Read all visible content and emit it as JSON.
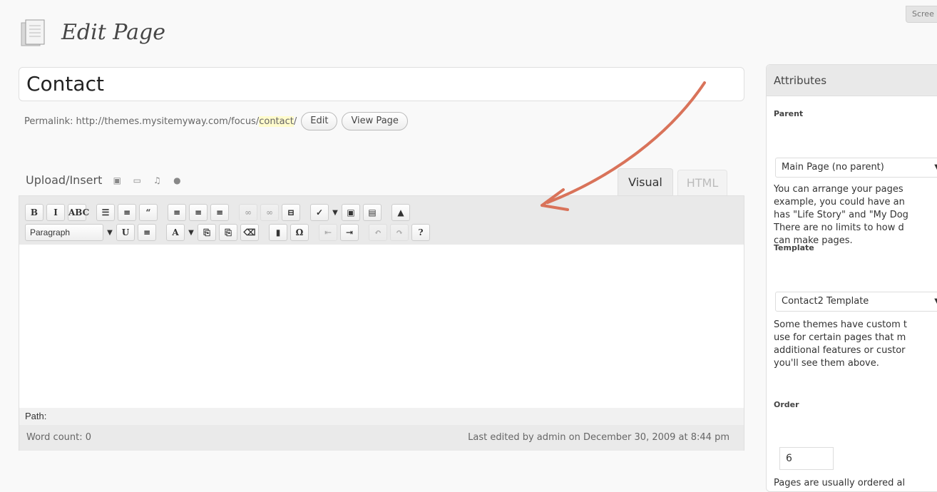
{
  "screen_options": {
    "label": "Scree"
  },
  "header": {
    "title": "Edit Page",
    "icon": "pages-icon"
  },
  "post": {
    "title": "Contact"
  },
  "permalink": {
    "label": "Permalink:",
    "base": "http://themes.mysitemyway.com/focus/",
    "slug": "contact",
    "trailing": "/",
    "edit_label": "Edit",
    "view_label": "View Page"
  },
  "media": {
    "label": "Upload/Insert",
    "icons": [
      "image-icon",
      "video-icon",
      "audio-icon",
      "media-icon"
    ]
  },
  "editor_tabs": {
    "visual": "Visual",
    "html": "HTML"
  },
  "toolbar": {
    "row1": [
      {
        "name": "bold-button",
        "glyph": "B"
      },
      {
        "name": "italic-button",
        "glyph": "I"
      },
      {
        "name": "strikethrough-button",
        "glyph": "ABC"
      },
      {
        "name": "bullet-list-button",
        "glyph": "☰"
      },
      {
        "name": "numbered-list-button",
        "glyph": "≡"
      },
      {
        "name": "blockquote-button",
        "glyph": "“"
      },
      {
        "name": "align-left-button",
        "glyph": "≡"
      },
      {
        "name": "align-center-button",
        "glyph": "≡"
      },
      {
        "name": "align-right-button",
        "glyph": "≡"
      },
      {
        "name": "link-button",
        "glyph": "∞"
      },
      {
        "name": "unlink-button",
        "glyph": "∞"
      },
      {
        "name": "more-tag-button",
        "glyph": "⊟"
      },
      {
        "name": "spellcheck-button",
        "glyph": "✓"
      },
      {
        "name": "fullscreen-button",
        "glyph": "▣"
      },
      {
        "name": "kitchen-sink-button",
        "glyph": "▤"
      },
      {
        "name": "custom-button",
        "glyph": "▲"
      }
    ],
    "format_select": "Paragraph",
    "row2": [
      {
        "name": "underline-button",
        "glyph": "U"
      },
      {
        "name": "justify-button",
        "glyph": "≡"
      },
      {
        "name": "text-color-button",
        "glyph": "A"
      },
      {
        "name": "paste-text-button",
        "glyph": "⎘"
      },
      {
        "name": "paste-word-button",
        "glyph": "⎘"
      },
      {
        "name": "remove-format-button",
        "glyph": "⌫"
      },
      {
        "name": "insert-media-button",
        "glyph": "▮"
      },
      {
        "name": "special-char-button",
        "glyph": "Ω"
      },
      {
        "name": "outdent-button",
        "glyph": "⇤"
      },
      {
        "name": "indent-button",
        "glyph": "⇥"
      },
      {
        "name": "undo-button",
        "glyph": "↶"
      },
      {
        "name": "redo-button",
        "glyph": "↷"
      },
      {
        "name": "help-button",
        "glyph": "?"
      }
    ]
  },
  "editor": {
    "path_label": "Path:",
    "word_count": "Word count: 0",
    "last_edited": "Last edited by admin on December 30, 2009 at 8:44 pm"
  },
  "attributes": {
    "title": "Attributes",
    "parent_label": "Parent",
    "parent_value": "Main Page (no parent)",
    "parent_help": [
      "You can arrange your pages",
      "example, you could have an",
      "has \"Life Story\" and \"My Dog",
      "There are no limits to how d",
      "can make pages."
    ],
    "template_label": "Template",
    "template_value": "Contact2 Template",
    "template_help": [
      "Some themes have custom t",
      "use for certain pages that m",
      "additional features or custor",
      "you'll see them above."
    ],
    "order_label": "Order",
    "order_value": "6",
    "order_help": "Pages are usually ordered al"
  },
  "annotation": {
    "arrow_color": "#d9735a"
  }
}
